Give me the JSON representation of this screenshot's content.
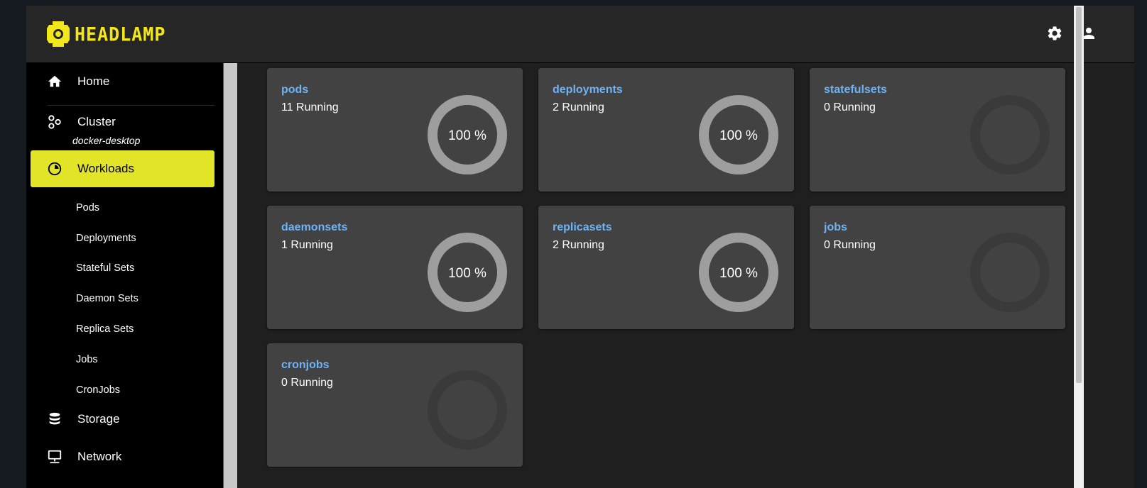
{
  "app": {
    "name": "HEADLAMP"
  },
  "sidebar": {
    "home": "Home",
    "cluster": {
      "label": "Cluster",
      "name": "docker-desktop"
    },
    "workloads": "Workloads",
    "sub_items": [
      "Pods",
      "Deployments",
      "Stateful Sets",
      "Daemon Sets",
      "Replica Sets",
      "Jobs",
      "CronJobs"
    ],
    "storage": "Storage",
    "network": "Network"
  },
  "cards": [
    {
      "title": "pods",
      "status": "11 Running",
      "percent_label": "100 %",
      "percent": 100
    },
    {
      "title": "deployments",
      "status": "2 Running",
      "percent_label": "100 %",
      "percent": 100
    },
    {
      "title": "statefulsets",
      "status": "0 Running",
      "percent_label": "",
      "percent": 0
    },
    {
      "title": "daemonsets",
      "status": "1 Running",
      "percent_label": "100 %",
      "percent": 100
    },
    {
      "title": "replicasets",
      "status": "2 Running",
      "percent_label": "100 %",
      "percent": 100
    },
    {
      "title": "jobs",
      "status": "0 Running",
      "percent_label": "",
      "percent": 0
    },
    {
      "title": "cronjobs",
      "status": "0 Running",
      "percent_label": "",
      "percent": 0
    }
  ],
  "colors": {
    "accent": "#e2e427",
    "link": "#6fb3f5",
    "ring_full": "#9e9e9e",
    "ring_empty": "#3a3a3a"
  },
  "icons": {
    "settings": "gear-icon",
    "account": "user-icon"
  }
}
